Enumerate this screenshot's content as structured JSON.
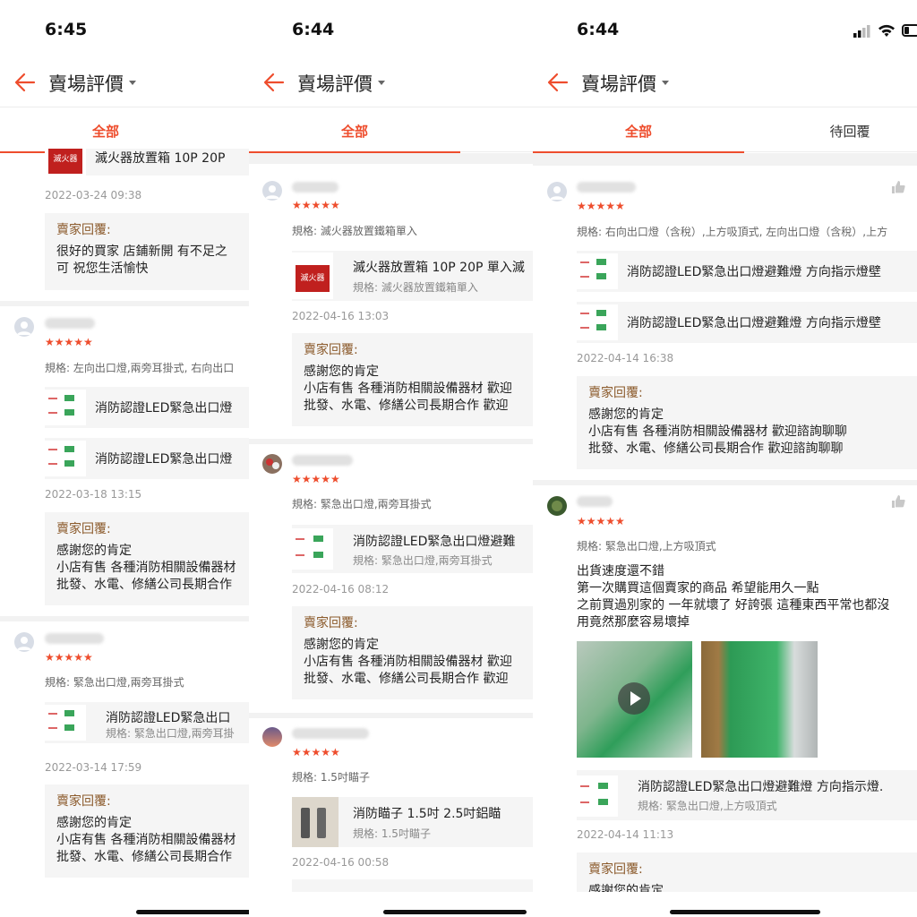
{
  "panels": [
    {
      "time": "6:45",
      "header": {
        "title": "賣場評價"
      },
      "tabs": [
        "全部"
      ],
      "reviews": [
        {
          "product": "滅火器放置箱 10P 20P",
          "product_img_text": "滅火器",
          "date": "2022-03-24 09:38",
          "reply_label": "賣家回覆:",
          "reply": "很好的買家 店鋪新開 有不足之\n可 祝您生活愉快"
        },
        {
          "rating": 5,
          "spec": "規格: 左向出口燈,兩旁耳掛式, 右向出口",
          "products": [
            "消防認證LED緊急出口燈",
            "消防認證LED緊急出口燈"
          ],
          "date": "2022-03-18 13:15",
          "reply_label": "賣家回覆:",
          "reply": "感謝您的肯定\n小店有售 各種消防相關設備器材\n批發、水電、修繕公司長期合作"
        },
        {
          "rating": 5,
          "spec": "規格: 緊急出口燈,兩旁耳掛式",
          "product": "消防認證LED緊急出口",
          "product_spec": "規格: 緊急出口燈,兩旁耳掛",
          "date": "2022-03-14 17:59",
          "reply_label": "賣家回覆:",
          "reply": "感謝您的肯定\n小店有售 各種消防相關設備器材\n批發、水電、修繕公司長期合作"
        }
      ]
    },
    {
      "time": "6:44",
      "header": {
        "title": "賣場評價"
      },
      "tabs": [
        "全部"
      ],
      "reviews": [
        {
          "rating": 5,
          "spec": "規格: 滅火器放置鐵箱單入",
          "product": "滅火器放置箱 10P 20P 單入滅",
          "product_spec": "規格: 滅火器放置鐵箱單入",
          "product_img_text": "滅火器",
          "date": "2022-04-16 13:03",
          "reply_label": "賣家回覆:",
          "reply": "感謝您的肯定\n小店有售 各種消防相關設備器材 歡迎\n批發、水電、修繕公司長期合作 歡迎"
        },
        {
          "rating": 5,
          "spec": "規格: 緊急出口燈,兩旁耳掛式",
          "product": "消防認證LED緊急出口燈避難",
          "product_spec": "規格: 緊急出口燈,兩旁耳掛式",
          "date": "2022-04-16 08:12",
          "reply_label": "賣家回覆:",
          "reply": "感謝您的肯定\n小店有售 各種消防相關設備器材 歡迎\n批發、水電、修繕公司長期合作 歡迎"
        },
        {
          "rating": 5,
          "spec": "規格: 1.5吋瞄子",
          "product": "消防瞄子 1.5吋 2.5吋鋁瞄",
          "product_spec": "規格: 1.5吋瞄子",
          "date": "2022-04-16 00:58"
        }
      ]
    },
    {
      "time": "6:44",
      "header": {
        "title": "賣場評價"
      },
      "tabs": [
        "全部",
        "待回覆"
      ],
      "reviews": [
        {
          "rating": 5,
          "spec": "規格: 右向出口燈（含稅）,上方吸頂式, 左向出口燈（含稅）,上方",
          "products": [
            "消防認證LED緊急出口燈避難燈 方向指示燈壁",
            "消防認證LED緊急出口燈避難燈 方向指示燈壁"
          ],
          "date": "2022-04-14 16:38",
          "reply_label": "賣家回覆:",
          "reply": "感謝您的肯定\n小店有售 各種消防相關設備器材 歡迎諮詢聊聊\n批發、水電、修繕公司長期合作 歡迎諮詢聊聊"
        },
        {
          "rating": 5,
          "spec": "規格: 緊急出口燈,上方吸頂式",
          "text": "出貨速度還不錯\n第一次購買這個賣家的商品 希望能用久一點\n之前買過別家的 一年就壞了 好誇張 這種東西平常也都沒\n用竟然那麼容易壞掉",
          "product": "消防認證LED緊急出口燈避難燈 方向指示燈.",
          "product_spec": "規格: 緊急出口燈,上方吸頂式",
          "date": "2022-04-14 11:13",
          "reply_label": "賣家回覆:",
          "reply": "感謝您的肯定"
        }
      ]
    }
  ],
  "icons": {
    "back": "back-arrow-icon",
    "star": "star-icon",
    "thumb": "thumbs-up-icon",
    "play": "play-icon",
    "signal": "signal-icon",
    "wifi": "wifi-icon",
    "battery": "battery-icon"
  },
  "colors": {
    "accent": "#ee4d2d",
    "reply_label": "#8b5a2b",
    "reply_bg": "#f5f5f5"
  },
  "star_glyphs": "★★★★★"
}
